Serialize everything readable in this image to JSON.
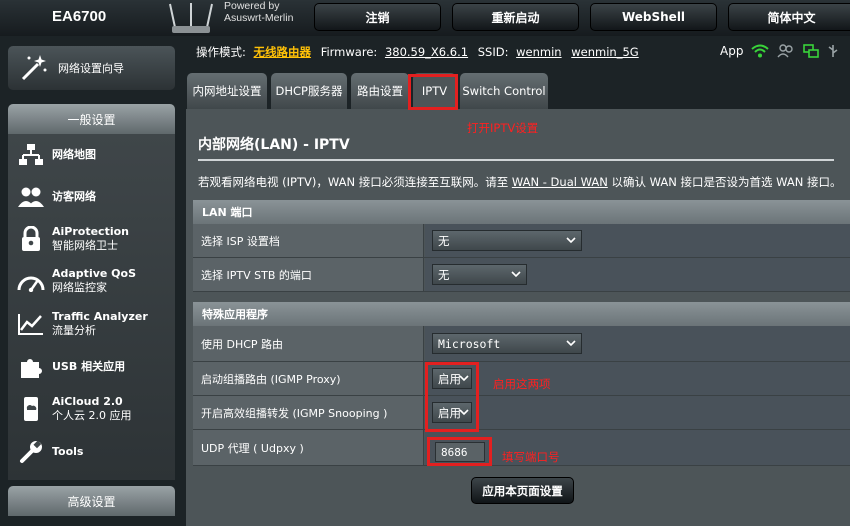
{
  "header": {
    "model": "EA6700",
    "powered_by": "Powered by",
    "firmware_brand": "Asuswrt-Merlin",
    "buttons": [
      "注销",
      "重新启动",
      "WebShell",
      "简体中文"
    ]
  },
  "status": {
    "mode_label": "操作模式:",
    "mode_value": "无线路由器",
    "firmware_label": "Firmware:",
    "firmware_value": "380.59_X6.6.1",
    "ssid_label": "SSID:",
    "ssid_1": "wenmin",
    "ssid_2": "wenmin_5G",
    "app_label": "App"
  },
  "sidebar": {
    "wizard": "网络设置向导",
    "general_header": "一般设置",
    "items": [
      {
        "label": "网络地图",
        "sub": "",
        "icon": "network-map-icon"
      },
      {
        "label": "访客网络",
        "sub": "",
        "icon": "guest-network-icon"
      },
      {
        "label": "AiProtection",
        "sub": "智能网络卫士",
        "icon": "aiprotection-lock-icon"
      },
      {
        "label": "Adaptive QoS",
        "sub": "网络监控家",
        "icon": "qos-gauge-icon"
      },
      {
        "label": "Traffic Analyzer",
        "sub": "流量分析",
        "icon": "traffic-chart-icon"
      },
      {
        "label": "USB 相关应用",
        "sub": "",
        "icon": "usb-puzzle-icon"
      },
      {
        "label": "AiCloud 2.0",
        "sub": "个人云 2.0 应用",
        "icon": "aicloud-icon"
      },
      {
        "label": "Tools",
        "sub": "",
        "icon": "tools-wrench-icon"
      }
    ],
    "advanced_header": "高级设置"
  },
  "tabs": [
    "内网地址设置",
    "DHCP服务器",
    "路由设置",
    "IPTV",
    "Switch Control"
  ],
  "annotations": {
    "open_iptv": "打开IPTV设置",
    "enable_both": "启用这两项",
    "fill_port": "填写端口号"
  },
  "page": {
    "title": "内部网络(LAN) - IPTV",
    "desc_pre": "若观看网络电视 (IPTV)，WAN 接口必须连接至互联网。请至 ",
    "desc_link": "WAN - Dual WAN",
    "desc_post": " 以确认 WAN 接口是否设为首选 WAN 接口。"
  },
  "lan_section": {
    "header": "LAN 端口",
    "isp_label": "选择 ISP 设置档",
    "isp_value": "无",
    "stb_label": "选择 IPTV STB 的端口",
    "stb_value": "无"
  },
  "special_section": {
    "header": "特殊应用程序",
    "dhcp_label": "使用 DHCP 路由",
    "dhcp_value": "Microsoft",
    "igmp_proxy_label": "启动组播路由 (IGMP Proxy)",
    "igmp_proxy_value": "启用",
    "igmp_snoop_label": "开启高效组播转发 (IGMP Snooping )",
    "igmp_snoop_value": "启用",
    "udpxy_label": "UDP 代理 ( Udpxy )",
    "udpxy_value": "8686"
  },
  "apply_label": "应用本页面设置",
  "colors": {
    "highlight": "#e32020",
    "annotation": "#ff2020",
    "accent": "#ffc107"
  }
}
